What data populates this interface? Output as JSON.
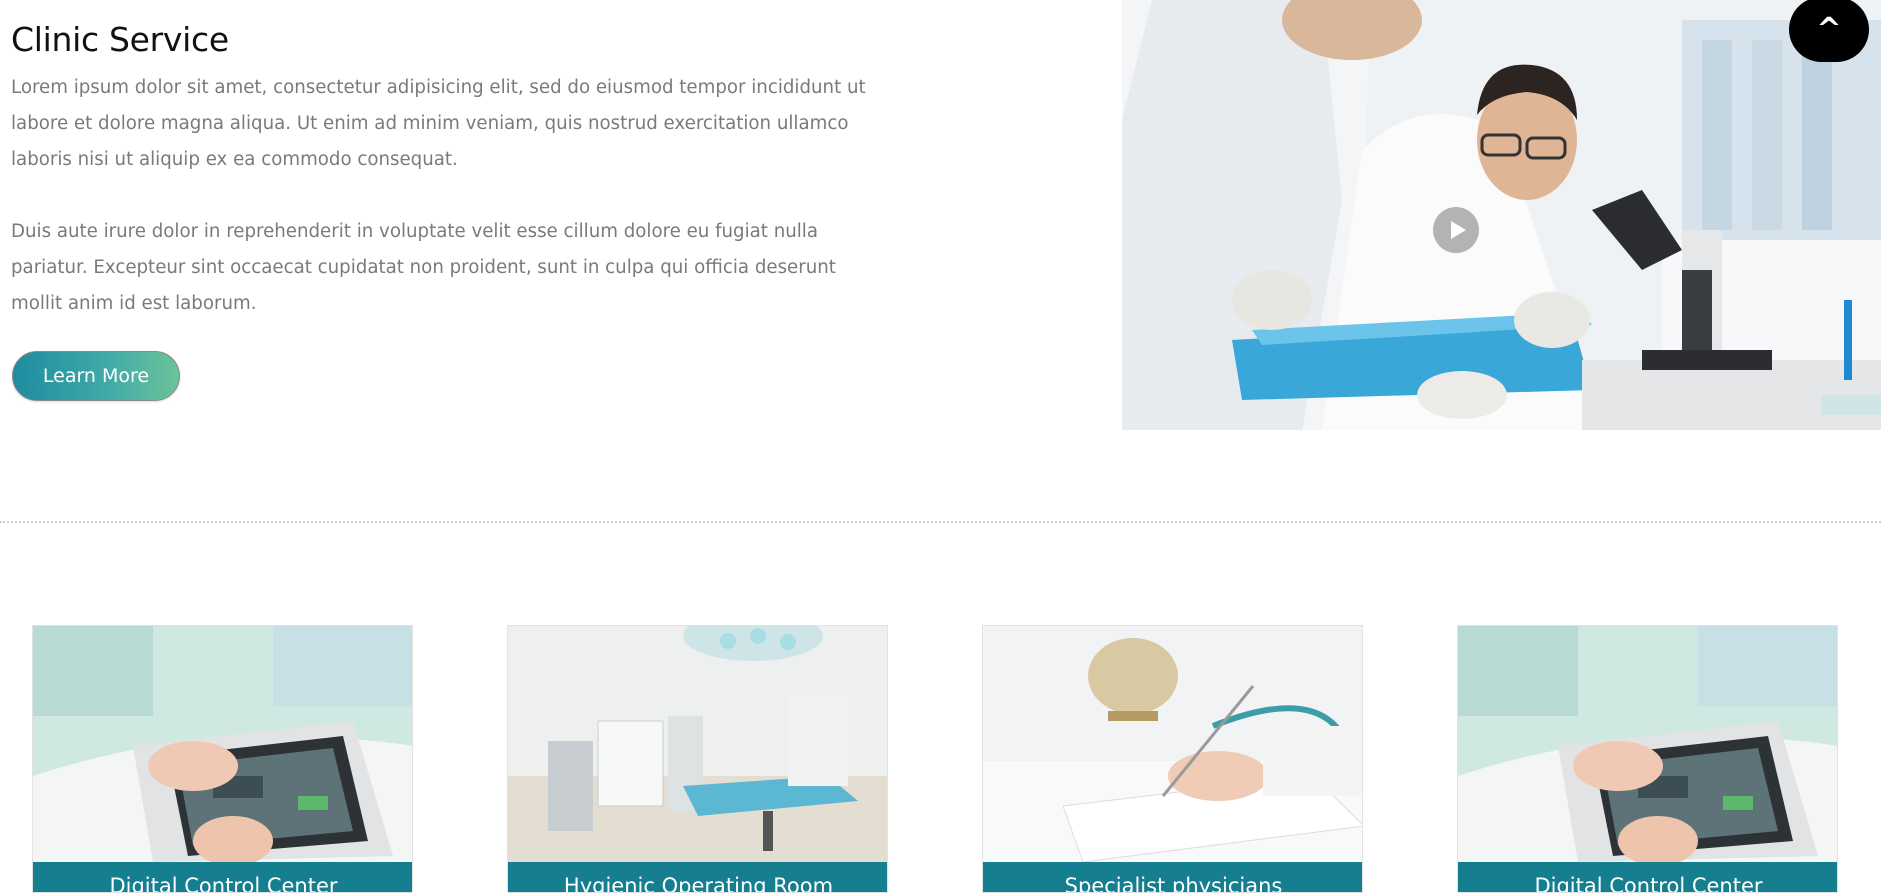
{
  "section": {
    "title": "Clinic Service",
    "paragraph_1": "Lorem ipsum dolor sit amet, consectetur adipisicing elit, sed do eiusmod tempor incididunt ut labore et dolore magna aliqua. Ut enim ad minim veniam, quis nostrud exercitation ullamco laboris nisi ut aliquip ex ea commodo consequat.",
    "paragraph_2": "Duis aute irure dolor in reprehenderit in voluptate velit esse cillum dolore eu fugiat nulla pariatur. Excepteur sint occaecat cupidatat non proident, sunt in culpa qui officia deserunt mollit anim id est laborum.",
    "button_label": "Learn More"
  },
  "hero": {
    "video_icon": "play-icon"
  },
  "scroll_top": {
    "label": "^"
  },
  "cards": [
    {
      "title": "Digital Control Center",
      "image": "touchscreen-monitor"
    },
    {
      "title": "Hygienic Operating Room",
      "image": "operating-room"
    },
    {
      "title": "Specialist physicians",
      "image": "doctor-writing"
    },
    {
      "title": "Digital Control Center",
      "image": "touchscreen-monitor"
    }
  ],
  "colors": {
    "accent": "#157f8f",
    "button_gradient_start": "#1d8c9f",
    "button_gradient_end": "#6cc39a"
  }
}
